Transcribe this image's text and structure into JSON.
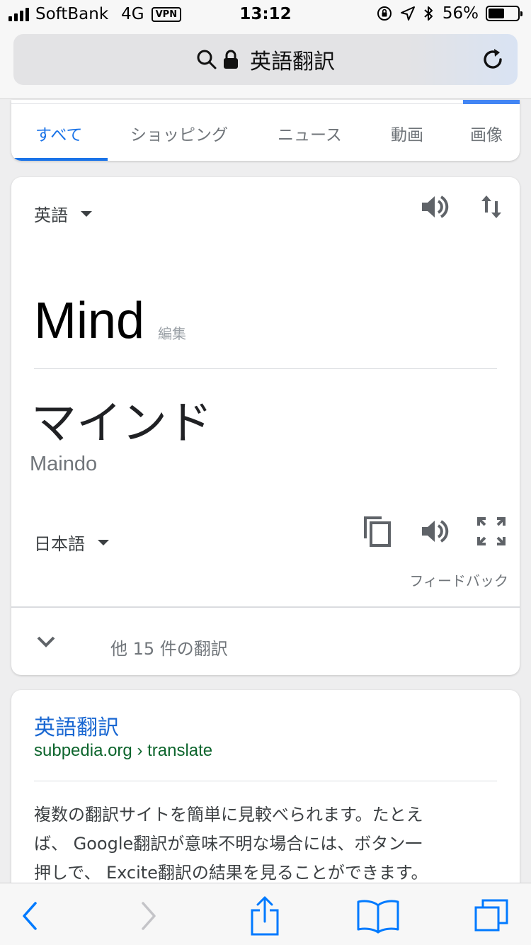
{
  "status_bar": {
    "carrier": "SoftBank",
    "network": "4G",
    "vpn": "VPN",
    "time": "13:12",
    "battery_percent": "56%",
    "battery_level": 0.56,
    "icons": [
      "signal-icon",
      "orientation-lock-icon",
      "location-icon",
      "bluetooth-icon",
      "battery-icon"
    ]
  },
  "address_bar": {
    "title": "英語翻訳",
    "icons": [
      "search-icon",
      "lock-icon",
      "reload-icon"
    ]
  },
  "tabs": [
    {
      "label": "すべて",
      "active": true
    },
    {
      "label": "ショッピング",
      "active": false
    },
    {
      "label": "ニュース",
      "active": false
    },
    {
      "label": "動画",
      "active": false
    },
    {
      "label": "画像",
      "active": false
    }
  ],
  "translator": {
    "source_lang": "英語",
    "source_text": "Mind",
    "edit_label": "編集",
    "target_text": "マインド",
    "romanization": "Maindo",
    "target_lang": "日本語",
    "feedback": "フィードバック",
    "more_translations": "他 15 件の翻訳",
    "icons": [
      "dropdown-caret-icon",
      "speaker-icon",
      "swap-languages-icon",
      "copy-icon",
      "fullscreen-icon",
      "chevron-down-icon"
    ]
  },
  "result": {
    "title": "英語翻訳",
    "url": "subpedia.org › translate",
    "snippet_lines": [
      "複数の翻訳サイトを簡単に見較べられます。たとえ",
      "ば、 Google翻訳が意味不明な場合には、ボタン一",
      "押しで、 Excite翻訳の結果を見ることができます。"
    ]
  },
  "toolbar": {
    "icons": [
      "back-icon",
      "forward-icon",
      "share-icon",
      "bookmarks-icon",
      "tabs-icon"
    ]
  },
  "colors": {
    "accent": "#1a73e8",
    "ios_blue": "#007aff",
    "url_green": "#0d652d"
  }
}
